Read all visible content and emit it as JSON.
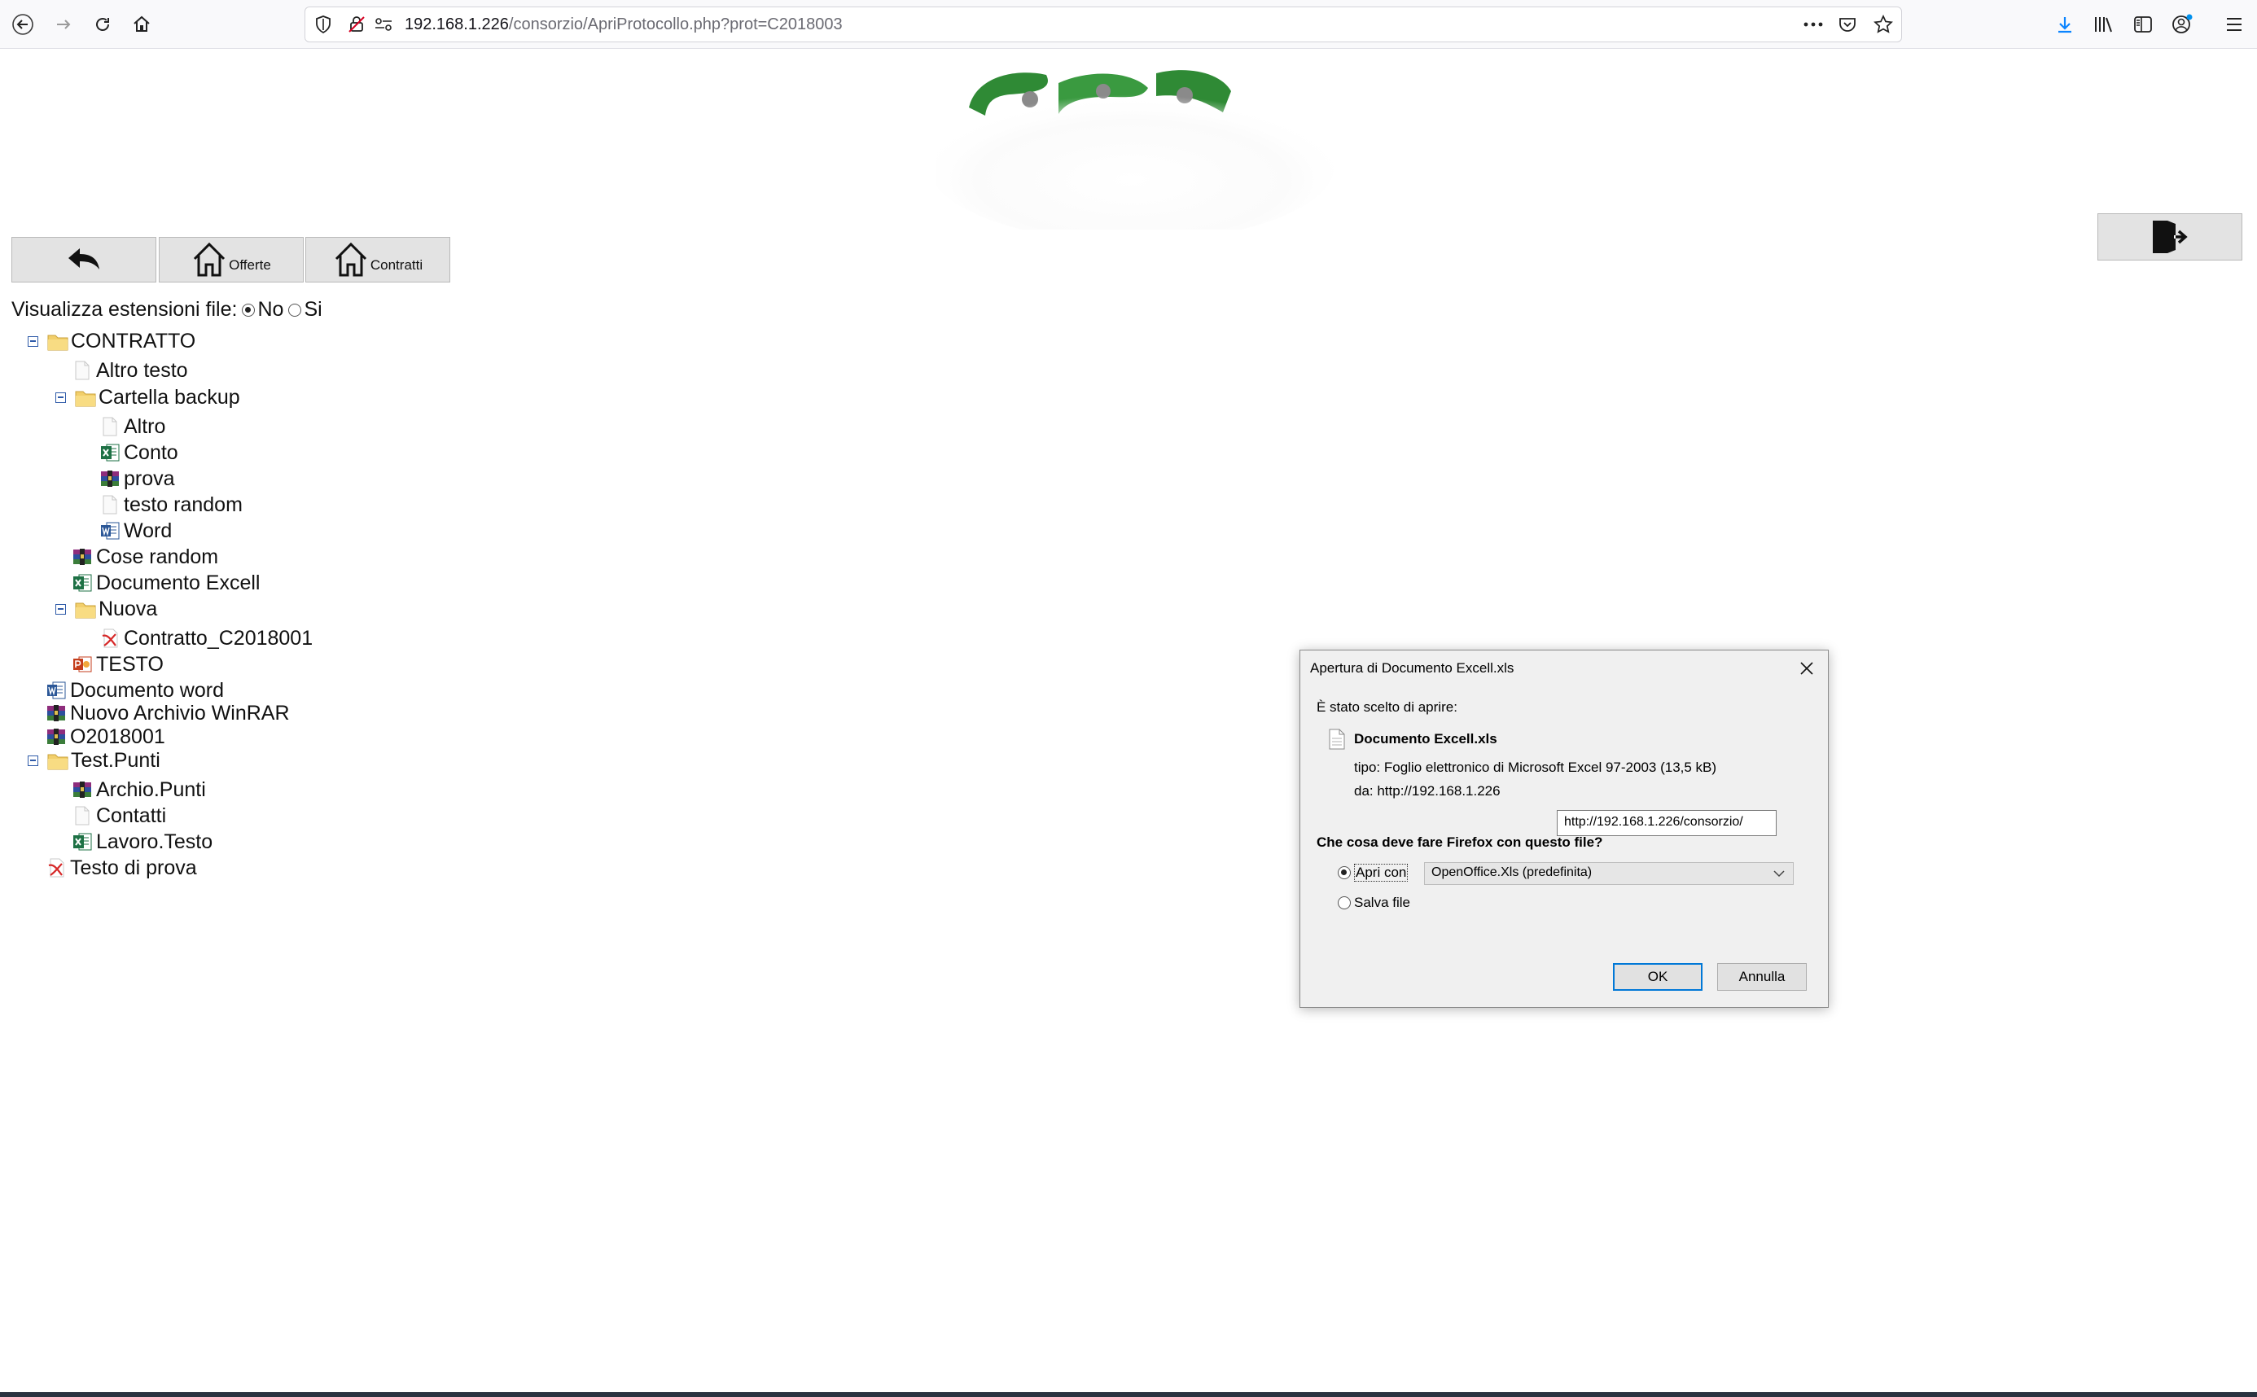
{
  "browser": {
    "url_host": "192.168.1.226",
    "url_path": "/consorzio/ApriProtocollo.php?prot=C2018003",
    "icons": [
      "back-arrow-icon",
      "forward-arrow-icon",
      "reload-icon",
      "home-icon",
      "shield-icon",
      "tracking-off-icon",
      "permissions-icon",
      "more-icon",
      "pocket-icon",
      "bookmark-star-icon",
      "download-icon",
      "library-icon",
      "sidebar-icon",
      "account-icon",
      "menu-icon"
    ]
  },
  "page": {
    "nav": {
      "offerte_label": "Offerte",
      "contratti_label": "Contratti"
    },
    "ext_toggle": {
      "label": "Visualizza estensioni file:",
      "no_label": "No",
      "si_label": "Si",
      "selected": "No"
    },
    "tree": [
      {
        "label": "CONTRATTO",
        "type": "folder",
        "expanded": true
      },
      {
        "label": "Altro testo",
        "type": "file"
      },
      {
        "label": "Cartella backup",
        "type": "folder",
        "expanded": true
      },
      {
        "label": "Altro",
        "type": "file"
      },
      {
        "label": "Conto",
        "type": "excel"
      },
      {
        "label": "prova",
        "type": "rar"
      },
      {
        "label": "testo random",
        "type": "file"
      },
      {
        "label": "Word",
        "type": "word"
      },
      {
        "label": "Cose random",
        "type": "rar"
      },
      {
        "label": "Documento Excell",
        "type": "excel"
      },
      {
        "label": "Nuova",
        "type": "folder",
        "expanded": true
      },
      {
        "label": "Contratto_C2018001",
        "type": "pdf"
      },
      {
        "label": "TESTO",
        "type": "ppt"
      },
      {
        "label": "Documento word",
        "type": "word"
      },
      {
        "label": "Nuovo Archivio WinRAR",
        "type": "rar"
      },
      {
        "label": "O2018001",
        "type": "rar"
      },
      {
        "label": "Test.Punti",
        "type": "folder",
        "expanded": true
      },
      {
        "label": "Archio.Punti",
        "type": "rar"
      },
      {
        "label": "Contatti",
        "type": "file"
      },
      {
        "label": "Lavoro.Testo",
        "type": "excel"
      },
      {
        "label": "Testo di prova",
        "type": "pdf"
      }
    ]
  },
  "dialog": {
    "title": "Apertura di Documento Excell.xls",
    "intro": "È stato scelto di aprire:",
    "filename": "Documento Excell.xls",
    "type_line": "tipo:  Foglio elettronico di Microsoft Excel 97-2003 (13,5 kB)",
    "from_line": "da:  http://192.168.1.226",
    "full_url": "http://192.168.1.226/consorzio/",
    "question": "Che cosa deve fare Firefox con questo file?",
    "open_with_label": "Apri con",
    "open_with_app": "OpenOffice.Xls (predefinita)",
    "save_label": "Salva file",
    "selected_option": "Apri con",
    "ok_label": "OK",
    "cancel_label": "Annulla"
  }
}
